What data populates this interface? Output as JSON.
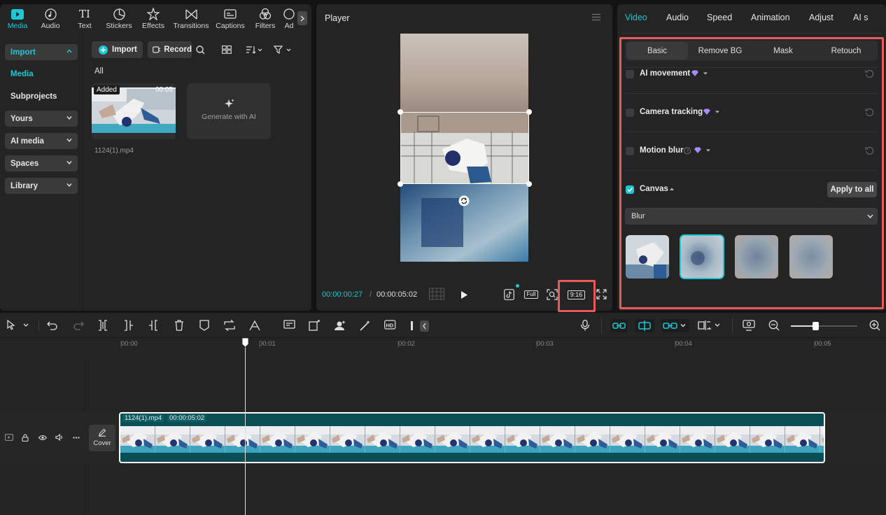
{
  "toolbar": {
    "tabs": [
      {
        "label": "Media",
        "icon": "media-icon",
        "active": true
      },
      {
        "label": "Audio",
        "icon": "audio-icon"
      },
      {
        "label": "Text",
        "icon": "text-icon"
      },
      {
        "label": "Stickers",
        "icon": "stickers-icon"
      },
      {
        "label": "Effects",
        "icon": "effects-icon"
      },
      {
        "label": "Transitions",
        "icon": "transitions-icon"
      },
      {
        "label": "Captions",
        "icon": "captions-icon"
      },
      {
        "label": "Filters",
        "icon": "filters-icon"
      },
      {
        "label": "Ad",
        "icon": "adjust-icon"
      }
    ]
  },
  "sidebar": {
    "items": [
      {
        "label": "Import",
        "type": "dropdown-open"
      },
      {
        "label": "Media",
        "type": "selected"
      },
      {
        "label": "Subprojects",
        "type": "plain"
      },
      {
        "label": "Yours",
        "type": "dropdown"
      },
      {
        "label": "AI media",
        "type": "dropdown"
      },
      {
        "label": "Spaces",
        "type": "dropdown"
      },
      {
        "label": "Library",
        "type": "dropdown"
      }
    ]
  },
  "media": {
    "import_label": "Import",
    "record_label": "Record",
    "filter_label": "All",
    "clip": {
      "badge": "Added",
      "duration": "00:05",
      "filename": "1124(1).mp4"
    },
    "generate_label": "Generate with AI"
  },
  "player": {
    "title": "Player",
    "current_time": "00:00:00:27",
    "separator": "/",
    "total_time": "00:00:05:02",
    "full_label": "Full",
    "ratio_label": "9:16"
  },
  "inspector": {
    "tabs": [
      "Video",
      "Audio",
      "Speed",
      "Animation",
      "Adjust",
      "AI s"
    ],
    "active_tab": "Video",
    "subtabs": [
      "Basic",
      "Remove BG",
      "Mask",
      "Retouch"
    ],
    "active_subtab": "Basic",
    "rows": [
      {
        "label": "AI movement",
        "checked": false
      },
      {
        "label": "Camera tracking",
        "checked": false
      },
      {
        "label": "Motion blur",
        "checked": false
      }
    ],
    "canvas": {
      "label": "Canvas",
      "checked": true,
      "apply_all_label": "Apply to all",
      "select_value": "Blur",
      "selected_swatch": 1
    }
  },
  "timeline": {
    "ruler": [
      "00:00",
      "00:01",
      "00:02",
      "00:03",
      "00:04",
      "00:05"
    ],
    "clip_name": "1124(1).mp4",
    "clip_duration": "00:00:05:02",
    "cover_label": "Cover"
  },
  "colors": {
    "accent": "#21c6d3",
    "highlight": "#e85a57",
    "clip_track": "#0b4f55"
  }
}
